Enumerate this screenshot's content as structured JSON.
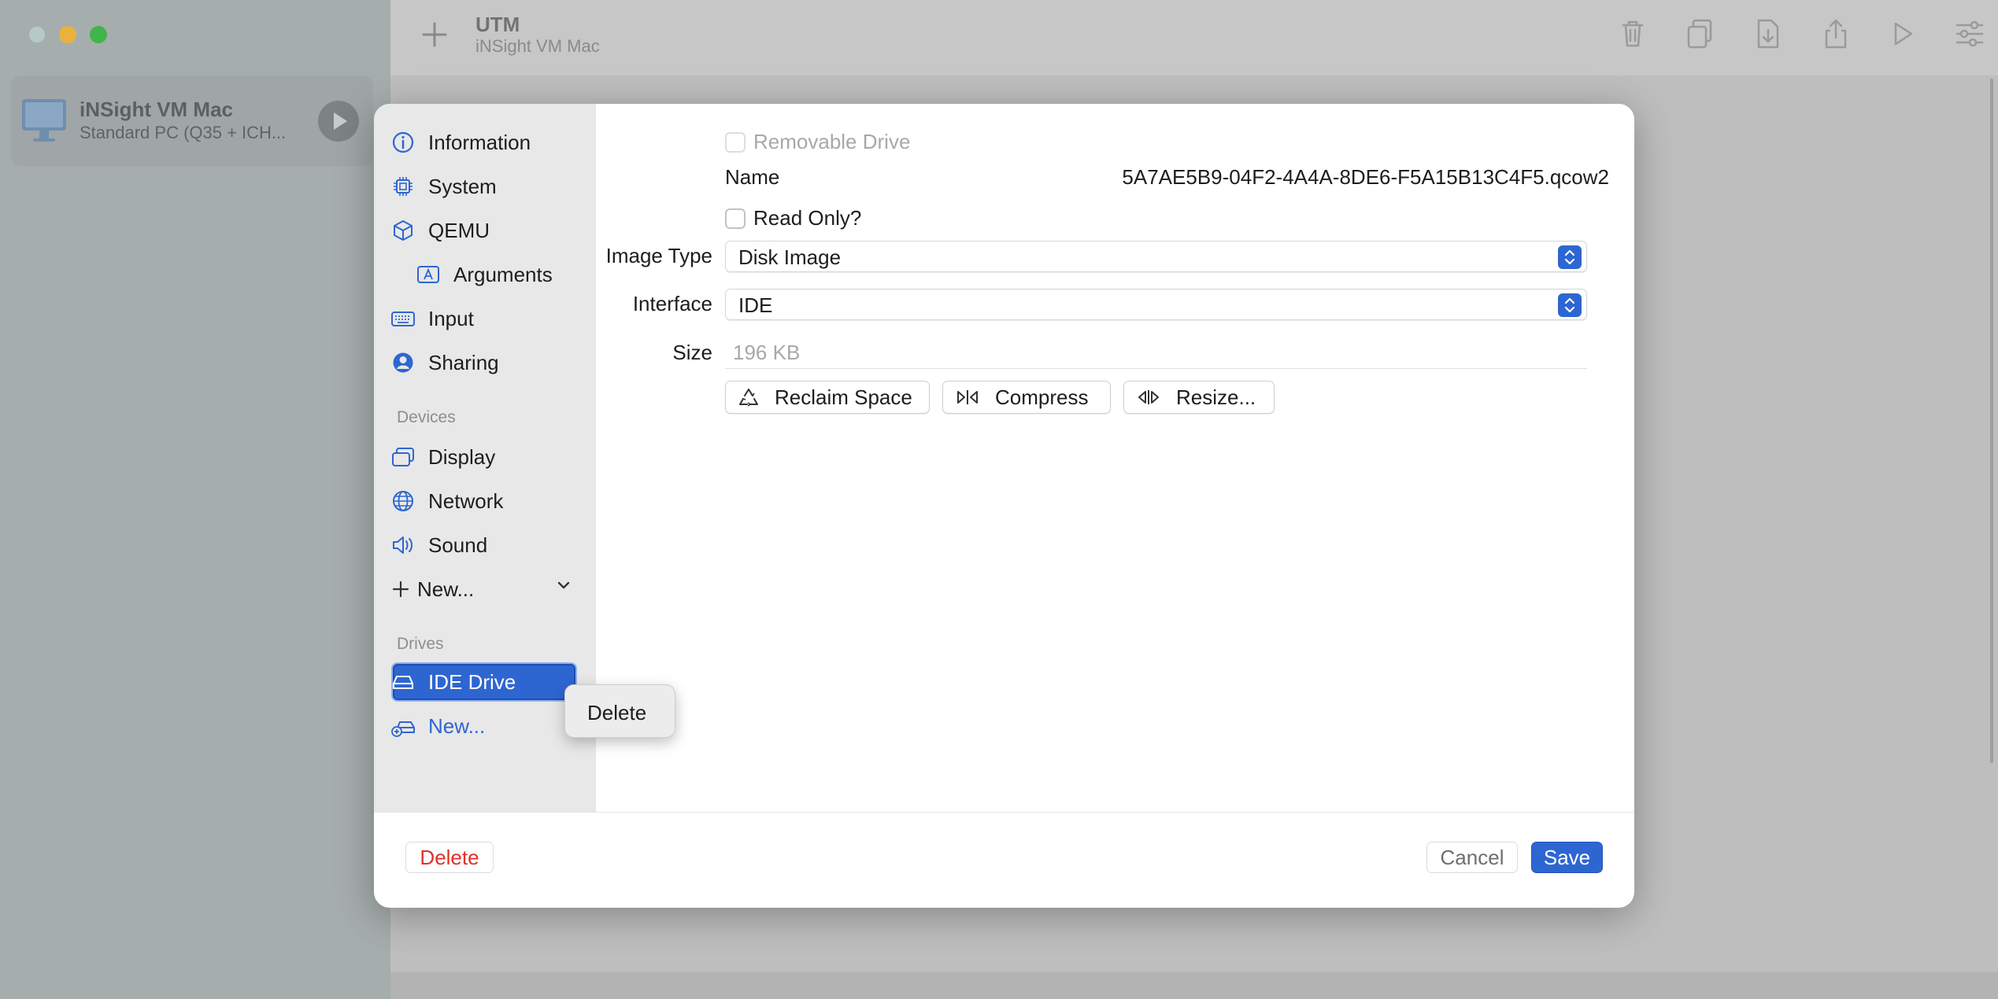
{
  "app": {
    "title": "UTM",
    "subtitle": "iNSight VM Mac"
  },
  "vm_list": [
    {
      "name": "iNSight VM Mac",
      "description": "Standard PC (Q35 + ICH..."
    }
  ],
  "toolbar_icons": [
    "plus-icon",
    "trash-icon",
    "clone-icon",
    "download-icon",
    "share-icon",
    "play-icon",
    "settings-sliders-icon"
  ],
  "dialog": {
    "sidebar": {
      "items": [
        {
          "label": "Information",
          "icon": "info-icon"
        },
        {
          "label": "System",
          "icon": "cpu-icon"
        },
        {
          "label": "QEMU",
          "icon": "cube-icon"
        },
        {
          "label": "Arguments",
          "icon": "arguments-icon"
        },
        {
          "label": "Input",
          "icon": "keyboard-icon"
        },
        {
          "label": "Sharing",
          "icon": "person-circle-icon"
        }
      ],
      "devices_header": "Devices",
      "devices": [
        {
          "label": "Display",
          "icon": "display-icon"
        },
        {
          "label": "Network",
          "icon": "globe-icon"
        },
        {
          "label": "Sound",
          "icon": "speaker-icon"
        },
        {
          "label": "New...",
          "icon": "plus-icon"
        }
      ],
      "drives_header": "Drives",
      "drives": [
        {
          "label": "IDE Drive",
          "icon": "drive-icon",
          "selected": true
        },
        {
          "label": "New...",
          "icon": "drive-add-icon"
        }
      ]
    },
    "form": {
      "removable_label": "Removable Drive",
      "name_label": "Name",
      "name_value": "5A7AE5B9-04F2-4A4A-8DE6-F5A15B13C4F5.qcow2",
      "readonly_label": "Read Only?",
      "image_type_label": "Image Type",
      "image_type_value": "Disk Image",
      "interface_label": "Interface",
      "interface_value": "IDE",
      "size_label": "Size",
      "size_value": "196 KB",
      "buttons": {
        "reclaim": "Reclaim Space",
        "compress": "Compress",
        "resize": "Resize..."
      }
    },
    "footer": {
      "delete": "Delete",
      "cancel": "Cancel",
      "save": "Save"
    }
  },
  "context_menu": {
    "items": [
      "Delete"
    ]
  },
  "colors": {
    "accent": "#2e66d1",
    "destructive": "#e0312c"
  }
}
